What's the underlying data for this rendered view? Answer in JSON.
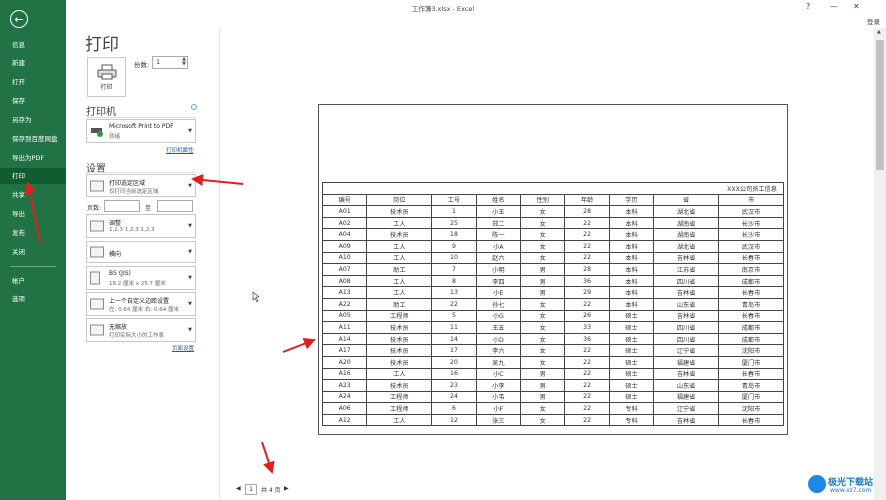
{
  "window": {
    "title": "工作簿3.xlsx - Excel",
    "help": "?",
    "minimize": "—",
    "close": "✕",
    "login": "登录"
  },
  "sidebar": {
    "back_glyph": "←",
    "items": [
      {
        "label": "信息"
      },
      {
        "label": "新建"
      },
      {
        "label": "打开"
      },
      {
        "label": "保存"
      },
      {
        "label": "另存为"
      },
      {
        "label": "保存到百度网盘"
      },
      {
        "label": "导出为PDF"
      },
      {
        "label": "打印"
      },
      {
        "label": "共享"
      },
      {
        "label": "导出"
      },
      {
        "label": "发布"
      },
      {
        "label": "关闭"
      }
    ],
    "bottom_items": [
      {
        "label": "帐户"
      },
      {
        "label": "选项"
      }
    ],
    "active": "打印"
  },
  "print": {
    "title": "打印",
    "button_label": "打印",
    "copies_label": "份数:",
    "copies_value": "1",
    "printer_heading": "打印机",
    "printer_name": "Microsoft Print to PDF",
    "printer_status": "就绪",
    "printer_props": "打印机属性",
    "settings_heading": "设置",
    "settings": [
      {
        "title": "打印选定区域",
        "subtitle": "仅打印当前选定区域",
        "icon": "sheet-area-icon"
      },
      {
        "title": "调整",
        "subtitle": "1,2,3    1,2,3    1,2,3",
        "icon": "collate-icon"
      },
      {
        "title": "横向",
        "subtitle": "",
        "icon": "landscape-icon"
      },
      {
        "title": "B5 (JIS)",
        "subtitle": "18.2 厘米 x 25.7 厘米",
        "icon": "paper-size-icon"
      },
      {
        "title": "上一个自定义边距设置",
        "subtitle": "左: 0.64 厘米    右: 0.64 厘米",
        "icon": "margins-icon"
      },
      {
        "title": "无缩放",
        "subtitle": "打印实际大小的工作表",
        "icon": "scaling-icon"
      }
    ],
    "pages_label": "页数:",
    "pages_to_label": "至",
    "page_setup_link": "页面设置"
  },
  "pager": {
    "prev": "◀",
    "current": "1",
    "total": "共 4 页",
    "next": "▶"
  },
  "sheet": {
    "title": "XXX公司员工信息",
    "headers": [
      "编号",
      "岗位",
      "工号",
      "姓名",
      "性别",
      "年龄",
      "学历",
      "省",
      "市"
    ],
    "rows": [
      [
        "A01",
        "技术员",
        "1",
        "小王",
        "女",
        "28",
        "本科",
        "湖北省",
        "武汉市"
      ],
      [
        "A02",
        "工人",
        "25",
        "郑二",
        "女",
        "22",
        "本科",
        "湖南省",
        "长沙市"
      ],
      [
        "A04",
        "技术员",
        "18",
        "陈一",
        "女",
        "22",
        "本科",
        "湖南省",
        "长沙市"
      ],
      [
        "A09",
        "工人",
        "9",
        "小A",
        "女",
        "22",
        "本科",
        "湖北省",
        "武汉市"
      ],
      [
        "A10",
        "工人",
        "10",
        "赵六",
        "女",
        "22",
        "本科",
        "吉林省",
        "长春市"
      ],
      [
        "A07",
        "助工",
        "7",
        "小明",
        "男",
        "28",
        "本科",
        "江苏省",
        "南京市"
      ],
      [
        "A08",
        "工人",
        "8",
        "李四",
        "男",
        "36",
        "本科",
        "四川省",
        "成都市"
      ],
      [
        "A13",
        "工人",
        "13",
        "小E",
        "男",
        "29",
        "本科",
        "吉林省",
        "长春市"
      ],
      [
        "A22",
        "助工",
        "22",
        "孙七",
        "女",
        "22",
        "本科",
        "山东省",
        "青岛市"
      ],
      [
        "A05",
        "工程师",
        "5",
        "小G",
        "女",
        "26",
        "硕士",
        "吉林省",
        "长春市"
      ],
      [
        "A11",
        "技术员",
        "11",
        "王五",
        "女",
        "33",
        "硕士",
        "四川省",
        "成都市"
      ],
      [
        "A14",
        "技术员",
        "14",
        "小D",
        "女",
        "36",
        "硕士",
        "四川省",
        "成都市"
      ],
      [
        "A17",
        "技术员",
        "17",
        "李六",
        "女",
        "22",
        "硕士",
        "辽宁省",
        "沈阳市"
      ],
      [
        "A20",
        "技术员",
        "20",
        "吴九",
        "女",
        "22",
        "硕士",
        "福建省",
        "厦门市"
      ],
      [
        "A16",
        "工人",
        "16",
        "小C",
        "男",
        "22",
        "硕士",
        "吉林省",
        "长春市"
      ],
      [
        "A23",
        "技术员",
        "23",
        "小李",
        "男",
        "22",
        "硕士",
        "山东省",
        "青岛市"
      ],
      [
        "A24",
        "工程师",
        "24",
        "小韦",
        "男",
        "22",
        "硕士",
        "福建省",
        "厦门市"
      ],
      [
        "A06",
        "工程师",
        "6",
        "小F",
        "女",
        "22",
        "专科",
        "辽宁省",
        "沈阳市"
      ],
      [
        "A12",
        "工人",
        "12",
        "张三",
        "女",
        "22",
        "专科",
        "吉林省",
        "长春市"
      ]
    ]
  },
  "watermark": {
    "line1": "极光下载站",
    "line2": "www.xz7.com"
  },
  "colors": {
    "sidebar": "#217346",
    "active": "#0e5c2f",
    "arrow": "#e02020",
    "link": "#2b579a"
  }
}
